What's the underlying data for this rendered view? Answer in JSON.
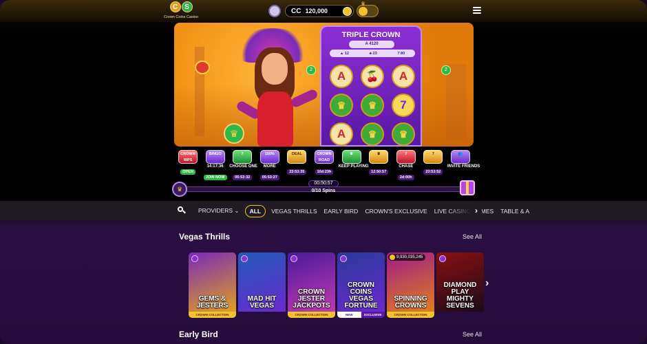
{
  "header": {
    "logo_text": "Crown Coins Casino",
    "logo_letters": [
      "C",
      "S"
    ],
    "balance": {
      "currency": "CC",
      "amount": "120,000"
    },
    "icons": [
      "avatar-icon",
      "gold-coin-icon",
      "sweeps-coin-icon",
      "menu-icon"
    ]
  },
  "hero": {
    "slot_title": "TRIPLE CROWN",
    "slot_sub": "A 4120",
    "slot_pays": [
      "▲ 12",
      "♣ 23",
      "7 80"
    ],
    "reels": [
      "A",
      "🍒",
      "A",
      "♛",
      "♛",
      "7",
      "A",
      "♛",
      "♛"
    ],
    "coins": [
      "2",
      "2"
    ]
  },
  "promos": [
    {
      "icon": "CROWN RIPS",
      "label": "",
      "tag": "OPEN",
      "tag_style": "green",
      "style": "red"
    },
    {
      "icon": "BINGO",
      "label": "14:17:36",
      "tag": "JOIN NOW",
      "tag_style": "green",
      "style": ""
    },
    {
      "icon": "7",
      "label": "CHOOSE ONE",
      "tag": "05:53:32",
      "tag_style": "purple",
      "style": "green"
    },
    {
      "icon": "150%",
      "label": "MORE",
      "tag": "05:53:27",
      "tag_style": "purple",
      "style": ""
    },
    {
      "icon": "DEAL",
      "label": "",
      "tag": "23:53:35",
      "tag_style": "purple",
      "style": "gold"
    },
    {
      "icon": "CROWN ROAD",
      "label": "",
      "tag": "10d:23h",
      "tag_style": "purple",
      "style": ""
    },
    {
      "icon": "♛",
      "label": "KEEP PLAYING",
      "tag": "",
      "tag_style": "",
      "style": "green"
    },
    {
      "icon": "♛",
      "label": "",
      "tag": "12:50:57",
      "tag_style": "purple",
      "style": "gold"
    },
    {
      "icon": "7",
      "label": "CHASE",
      "tag": "2d:00h",
      "tag_style": "purple",
      "style": "red"
    },
    {
      "icon": "7",
      "label": "",
      "tag": "23:53:52",
      "tag_style": "purple",
      "style": "gold"
    },
    {
      "icon": "👥",
      "label": "INVITE FRIENDS",
      "tag": "",
      "tag_style": "",
      "style": ""
    }
  ],
  "spins": {
    "timer": "00:50:57",
    "count": "0/10 Spins",
    "progress": 0.0
  },
  "categories": {
    "items": [
      "PROVIDERS ⌄",
      "ALL",
      "VEGAS THRILLS",
      "EARLY BIRD",
      "CROWN'S EXCLUSIVE",
      "LIVE CASINO GAMES",
      "TABLE & A"
    ],
    "active": "ALL"
  },
  "sections": [
    {
      "title": "Vegas Thrills",
      "see_all": "See All"
    },
    {
      "title": "Early Bird",
      "see_all": "See All"
    }
  ],
  "games": [
    {
      "title": "GEMS & JESTERS",
      "strip": "CROWN COLLECTION",
      "strip_alt": "",
      "jackpot": "",
      "colors": [
        "#7a2ab8",
        "#e0a020"
      ]
    },
    {
      "title": "MAD HIT VEGAS",
      "strip": "",
      "strip_alt": "",
      "jackpot": "",
      "colors": [
        "#1f5ab8",
        "#6a2ad0"
      ]
    },
    {
      "title": "CROWN JESTER JACKPOTS",
      "strip": "CROWN COLLECTION",
      "strip_alt": "",
      "jackpot": "",
      "colors": [
        "#4a1a9a",
        "#c03ab0"
      ]
    },
    {
      "title": "CROWN COINS VEGAS FORTUNE",
      "strip": "NEW",
      "strip_alt": "EXCLUSIVE",
      "jackpot": "",
      "colors": [
        "#2a3a9a",
        "#6a2ad0"
      ]
    },
    {
      "title": "SPINNING CROWNS",
      "strip": "CROWN COLLECTION",
      "strip_alt": "",
      "jackpot": "9,930,035,245",
      "colors": [
        "#a01a8a",
        "#e0801a"
      ]
    },
    {
      "title": "DIAMOND PLAY MIGHTY SEVENS",
      "strip": "",
      "strip_alt": "",
      "jackpot": "",
      "colors": [
        "#8a1010",
        "#1a0a1a"
      ]
    }
  ]
}
